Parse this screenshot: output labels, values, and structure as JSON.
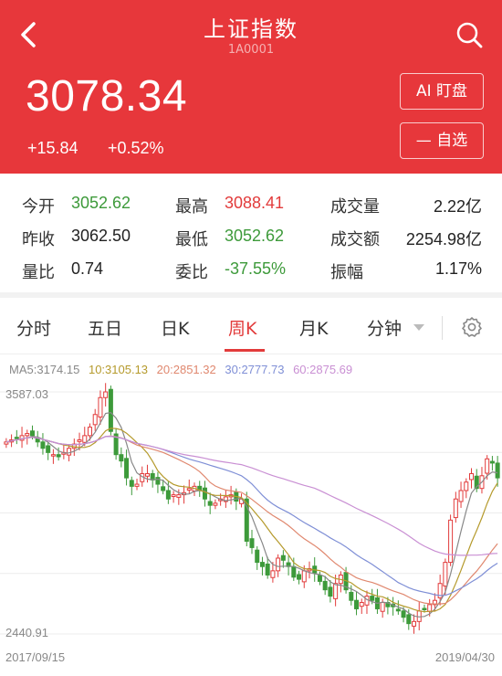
{
  "header": {
    "title": "上证指数",
    "code": "1A0001",
    "price": "3078.34",
    "change_abs": "+15.84",
    "change_pct": "+0.52%",
    "ai_button": "AI 盯盘",
    "favorite_button": "— 自选",
    "colors": {
      "background": "#e7373b"
    }
  },
  "stats": {
    "open_label": "今开",
    "open_value": "3052.62",
    "high_label": "最高",
    "high_value": "3088.41",
    "volume_label": "成交量",
    "volume_value": "2.22亿",
    "prev_close_label": "昨收",
    "prev_close_value": "3062.50",
    "low_label": "最低",
    "low_value": "3052.62",
    "amount_label": "成交额",
    "amount_value": "2254.98亿",
    "vol_ratio_label": "量比",
    "vol_ratio_value": "0.74",
    "commission_label": "委比",
    "commission_value": "-37.55%",
    "amplitude_label": "振幅",
    "amplitude_value": "1.17%",
    "colors": {
      "up": "#e23b3b",
      "down": "#3d9a3a"
    }
  },
  "tabs": {
    "items": [
      "分时",
      "五日",
      "日K",
      "周K",
      "月K",
      "分钟"
    ],
    "active": "周K"
  },
  "chart": {
    "ma_legend": {
      "ma5": "MA5:3174.15",
      "ma10": "10:3105.13",
      "ma20": "20:2851.32",
      "ma30": "30:2777.73",
      "ma60": "60:2875.69"
    },
    "ma_colors": {
      "ma5": "#888888",
      "ma10": "#b59a2c",
      "ma20": "#e0886f",
      "ma30": "#7f8fd6",
      "ma60": "#c98fd3"
    },
    "y_max_label": "3587.03",
    "y_min_label": "2440.91",
    "x_start_label": "2017/09/15",
    "x_end_label": "2019/04/30"
  },
  "chart_data": {
    "type": "candlestick",
    "title": "",
    "ylim": [
      2440.91,
      3587.03
    ],
    "x_range": [
      "2017/09/15",
      "2019/04/30"
    ],
    "grid": true,
    "weekly_close_approx": [
      3350,
      3360,
      3370,
      3380,
      3390,
      3380,
      3350,
      3320,
      3300,
      3290,
      3280,
      3300,
      3320,
      3340,
      3360,
      3380,
      3420,
      3480,
      3560,
      3587,
      3400,
      3290,
      3260,
      3180,
      3140,
      3150,
      3200,
      3200,
      3170,
      3150,
      3120,
      3080,
      3100,
      3100,
      3110,
      3130,
      3140,
      3120,
      3080,
      3050,
      3060,
      3080,
      3090,
      3100,
      3070,
      3080,
      2880,
      2850,
      2780,
      2760,
      2720,
      2740,
      2800,
      2790,
      2760,
      2710,
      2700,
      2740,
      2750,
      2730,
      2690,
      2650,
      2620,
      2680,
      2720,
      2650,
      2600,
      2560,
      2590,
      2620,
      2600,
      2560,
      2590,
      2570,
      2570,
      2550,
      2520,
      2490,
      2500,
      2550,
      2560,
      2580,
      2600,
      2680,
      2780,
      2980,
      3080,
      3120,
      3160,
      3200,
      3130,
      3190,
      3270,
      3250,
      3180
    ],
    "ma5_last": 3174.15,
    "ma10_last": 3105.13,
    "ma20_last": 2851.32,
    "ma30_last": 2777.73,
    "ma60_last": 2875.69
  }
}
